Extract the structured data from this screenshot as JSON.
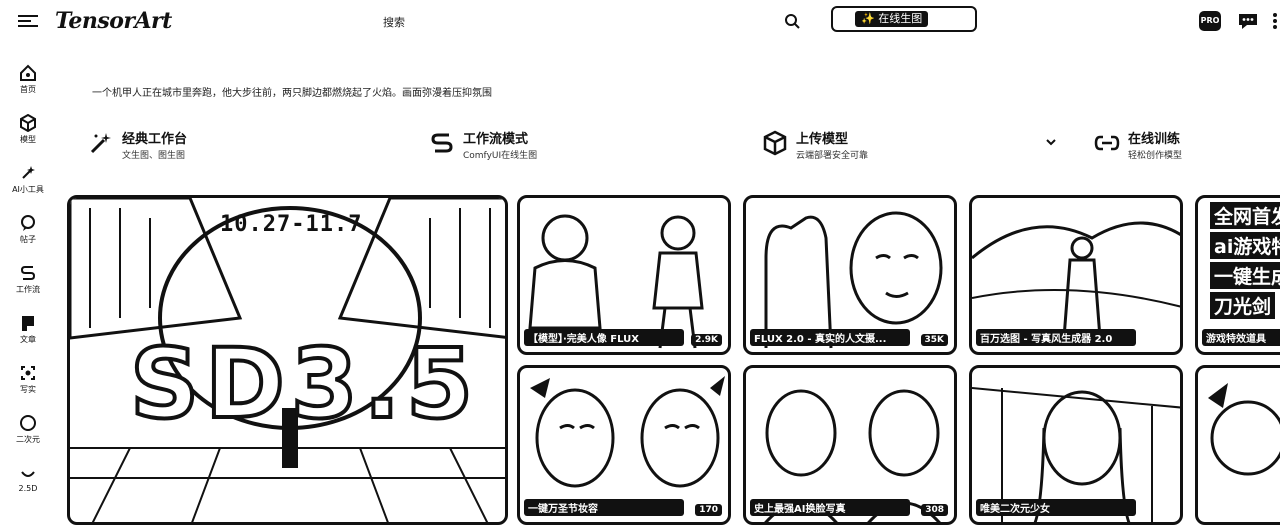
{
  "header": {
    "logo": "TensorArt",
    "search_label": "搜索",
    "search_ai_label": "✨ 在线生图",
    "pro_badge": "PRO"
  },
  "sidebar": {
    "items": [
      {
        "label": "首页",
        "icon": "home-icon"
      },
      {
        "label": "模型",
        "icon": "cube-icon"
      },
      {
        "label": "AI小工具",
        "icon": "tools-icon"
      },
      {
        "label": "帖子",
        "icon": "post-icon"
      },
      {
        "label": "工作流",
        "icon": "workflow-icon"
      },
      {
        "label": "文章",
        "icon": "article-icon"
      },
      {
        "label": "写实",
        "icon": "realistic-icon"
      },
      {
        "label": "二次元",
        "icon": "anime-icon"
      },
      {
        "label": "2.5D",
        "icon": "2-5d-icon"
      }
    ]
  },
  "prompt_text": "一个机甲人正在城市里奔跑，他大步往前，两只脚边都燃烧起了火焰。画面弥漫着压抑氛围",
  "tools": [
    {
      "title": "经典工作台",
      "subtitle": "文生图、图生图",
      "icon": "magic-wand-icon"
    },
    {
      "title": "工作流模式",
      "subtitle": "ComfyUI在线生图",
      "icon": "workflow-s-icon"
    },
    {
      "title": "上传模型",
      "subtitle": "云端部署安全可靠",
      "icon": "upload-cube-icon"
    },
    {
      "title": "在线训练",
      "subtitle": "轻松创作模型",
      "icon": "link-icon"
    }
  ],
  "banner": {
    "date": "10.27-11.7",
    "headline": "SD3.5"
  },
  "cards_row1": [
    {
      "caption": "【模型】·完美人像 FLUX",
      "count": "2.9K"
    },
    {
      "caption": "FLUX 2.0 - 真实的人文摄...",
      "count": "35K"
    },
    {
      "caption": "百万选图 - 写真风生成器 2.0",
      "count": ""
    },
    {
      "caption": "游戏特效道具",
      "count": ""
    }
  ],
  "cards_row2": [
    {
      "caption": "一键万圣节妆容",
      "count": "170"
    },
    {
      "caption": "史上最强AI换脸写真",
      "count": "308"
    },
    {
      "caption": "唯美二次元少女",
      "count": ""
    },
    {
      "caption": "",
      "count": ""
    }
  ],
  "side_card_texts": [
    "全网首发",
    "ai游戏特",
    "一键生成",
    "刀光剑"
  ]
}
